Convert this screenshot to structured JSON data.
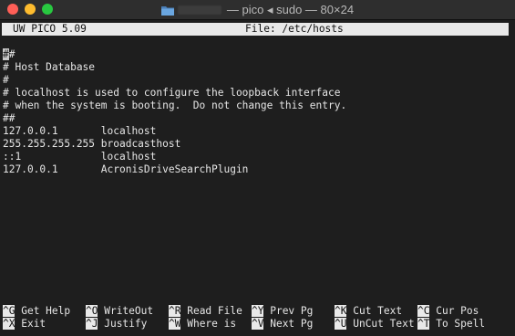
{
  "window": {
    "title": "— pico ◂ sudo — 80×24"
  },
  "editor": {
    "name": "UW PICO 5.09",
    "file_label": "File: /etc/hosts"
  },
  "content": {
    "lines": [
      "##",
      "# Host Database",
      "#",
      "# localhost is used to configure the loopback interface",
      "# when the system is booting.  Do not change this entry.",
      "##",
      "127.0.0.1       localhost",
      "255.255.255.255 broadcasthost",
      "::1             localhost",
      "127.0.0.1       AcronisDriveSearchPlugin"
    ]
  },
  "shortcuts": {
    "row1": [
      {
        "key": "^G",
        "label": "Get Help"
      },
      {
        "key": "^O",
        "label": "WriteOut"
      },
      {
        "key": "^R",
        "label": "Read File"
      },
      {
        "key": "^Y",
        "label": "Prev Pg"
      },
      {
        "key": "^K",
        "label": "Cut Text"
      },
      {
        "key": "^C",
        "label": "Cur Pos"
      }
    ],
    "row2": [
      {
        "key": "^X",
        "label": "Exit"
      },
      {
        "key": "^J",
        "label": "Justify"
      },
      {
        "key": "^W",
        "label": "Where is"
      },
      {
        "key": "^V",
        "label": "Next Pg"
      },
      {
        "key": "^U",
        "label": "UnCut Text"
      },
      {
        "key": "^T",
        "label": "To Spell"
      }
    ]
  },
  "colors": {
    "background": "#1e1e1e",
    "text": "#e6e6e6",
    "inverse_bar": "#e9e9e9",
    "close": "#ff5f57",
    "minimize": "#febc2e",
    "zoom": "#28c840"
  }
}
